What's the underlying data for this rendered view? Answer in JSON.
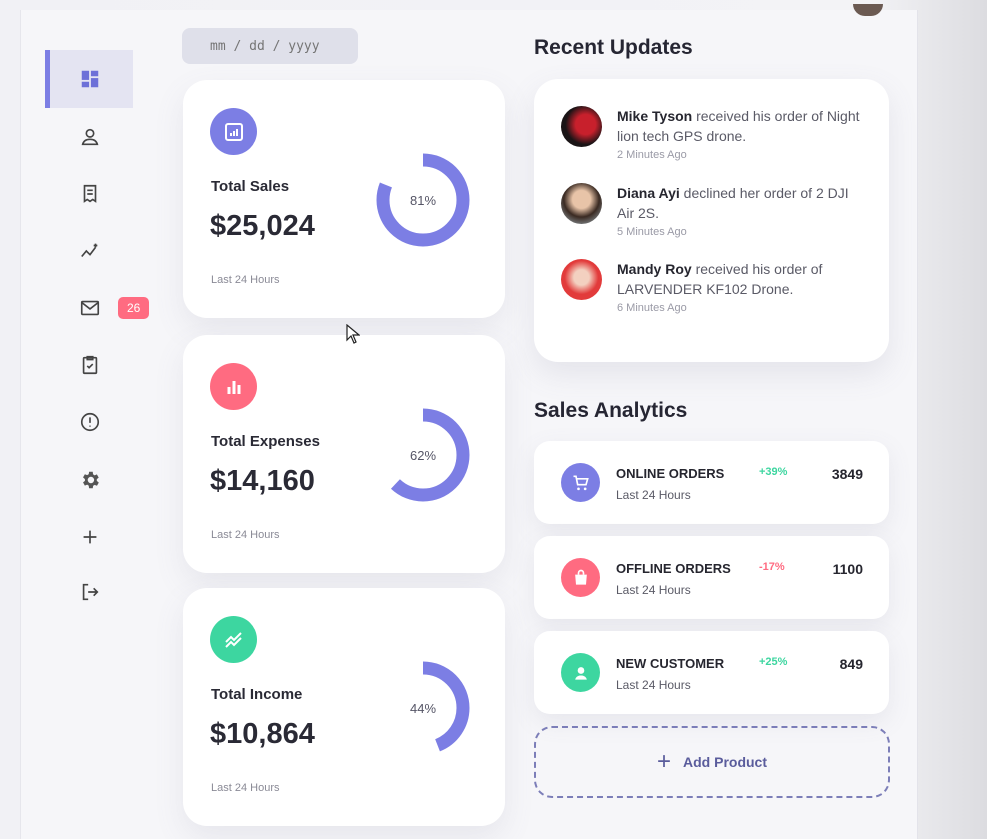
{
  "colors": {
    "accent": "#7c7ee4",
    "red": "#ff6b81",
    "green": "#3dd6a0",
    "ring": "#7c7ee4"
  },
  "sidebar": {
    "items": [
      {
        "icon": "dashboard-icon",
        "active": true
      },
      {
        "icon": "user-icon"
      },
      {
        "icon": "receipt-icon"
      },
      {
        "icon": "analytics-icon"
      },
      {
        "icon": "mail-icon",
        "badge": "26"
      },
      {
        "icon": "clipboard-check-icon"
      },
      {
        "icon": "alert-icon"
      },
      {
        "icon": "settings-icon"
      },
      {
        "icon": "plus-icon"
      },
      {
        "icon": "logout-icon"
      }
    ]
  },
  "date": {
    "placeholder": "mm / dd / yyyy"
  },
  "cards": [
    {
      "label": "Total Sales",
      "amount": "$25,024",
      "sub": "Last 24 Hours",
      "percent": 81,
      "percent_label": "81%",
      "icon": "bar-chart-icon",
      "color": "#7c7ee4"
    },
    {
      "label": "Total Expenses",
      "amount": "$14,160",
      "sub": "Last 24 Hours",
      "percent": 62,
      "percent_label": "62%",
      "icon": "bar-graph-icon",
      "color": "#ff6b81"
    },
    {
      "label": "Total Income",
      "amount": "$10,864",
      "sub": "Last 24 Hours",
      "percent": 44,
      "percent_label": "44%",
      "icon": "trending-icon",
      "color": "#3dd6a0"
    }
  ],
  "recent": {
    "title": "Recent Updates",
    "items": [
      {
        "name": "Mike Tyson",
        "text": " received his order of Night lion tech GPS drone.",
        "ago": "2 Minutes Ago"
      },
      {
        "name": "Diana Ayi",
        "text": " declined her order of 2 DJI Air 2S.",
        "ago": "5 Minutes Ago"
      },
      {
        "name": "Mandy Roy",
        "text": " received his order of LARVENDER KF102 Drone.",
        "ago": "6 Minutes Ago"
      }
    ]
  },
  "analytics": {
    "title": "Sales Analytics",
    "items": [
      {
        "name": "ONLINE ORDERS",
        "sub": "Last 24 Hours",
        "change": "+39%",
        "value": "3849",
        "icon": "cart-icon",
        "color": "#7c7ee4",
        "change_color": "#3dd6a0"
      },
      {
        "name": "OFFLINE ORDERS",
        "sub": "Last 24 Hours",
        "change": "-17%",
        "value": "1100",
        "icon": "shopping-bag-icon",
        "color": "#ff6b81",
        "change_color": "#ff6b81"
      },
      {
        "name": "NEW CUSTOMER",
        "sub": "Last 24 Hours",
        "change": "+25%",
        "value": "849",
        "icon": "person-icon",
        "color": "#3dd6a0",
        "change_color": "#3dd6a0"
      }
    ],
    "add_label": "Add Product"
  }
}
